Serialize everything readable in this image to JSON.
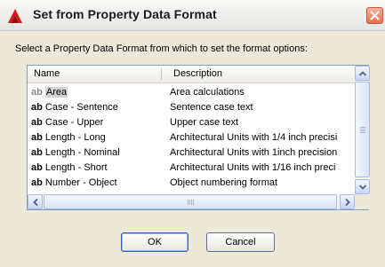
{
  "window": {
    "title": "Set from Property Data Format"
  },
  "prompt": "Select a Property Data Format from which to set the format options:",
  "list": {
    "columns": {
      "name": "Name",
      "description": "Description"
    },
    "rows": [
      {
        "icon": "ab",
        "name": "Area",
        "description": "Area calculations",
        "selected": true
      },
      {
        "icon": "ab",
        "name": "Case - Sentence",
        "description": "Sentence case text"
      },
      {
        "icon": "ab",
        "name": "Case - Upper",
        "description": "Upper case text"
      },
      {
        "icon": "ab",
        "name": "Length - Long",
        "description": "Architectural Units with 1/4 inch precisi"
      },
      {
        "icon": "ab",
        "name": "Length - Nominal",
        "description": "Architectural Units with 1inch precision"
      },
      {
        "icon": "ab",
        "name": "Length - Short",
        "description": "Architectural Units with 1/16 inch preci"
      },
      {
        "icon": "ab",
        "name": "Number - Object",
        "description": "Object numbering format"
      }
    ]
  },
  "buttons": {
    "ok": "OK",
    "cancel": "Cancel"
  },
  "icons": {
    "app": "autocad-logo-icon",
    "close": "close-icon"
  },
  "colors": {
    "accent": "#3b5aa8",
    "selection": "#d3d3d3",
    "close": "#e5704f"
  }
}
